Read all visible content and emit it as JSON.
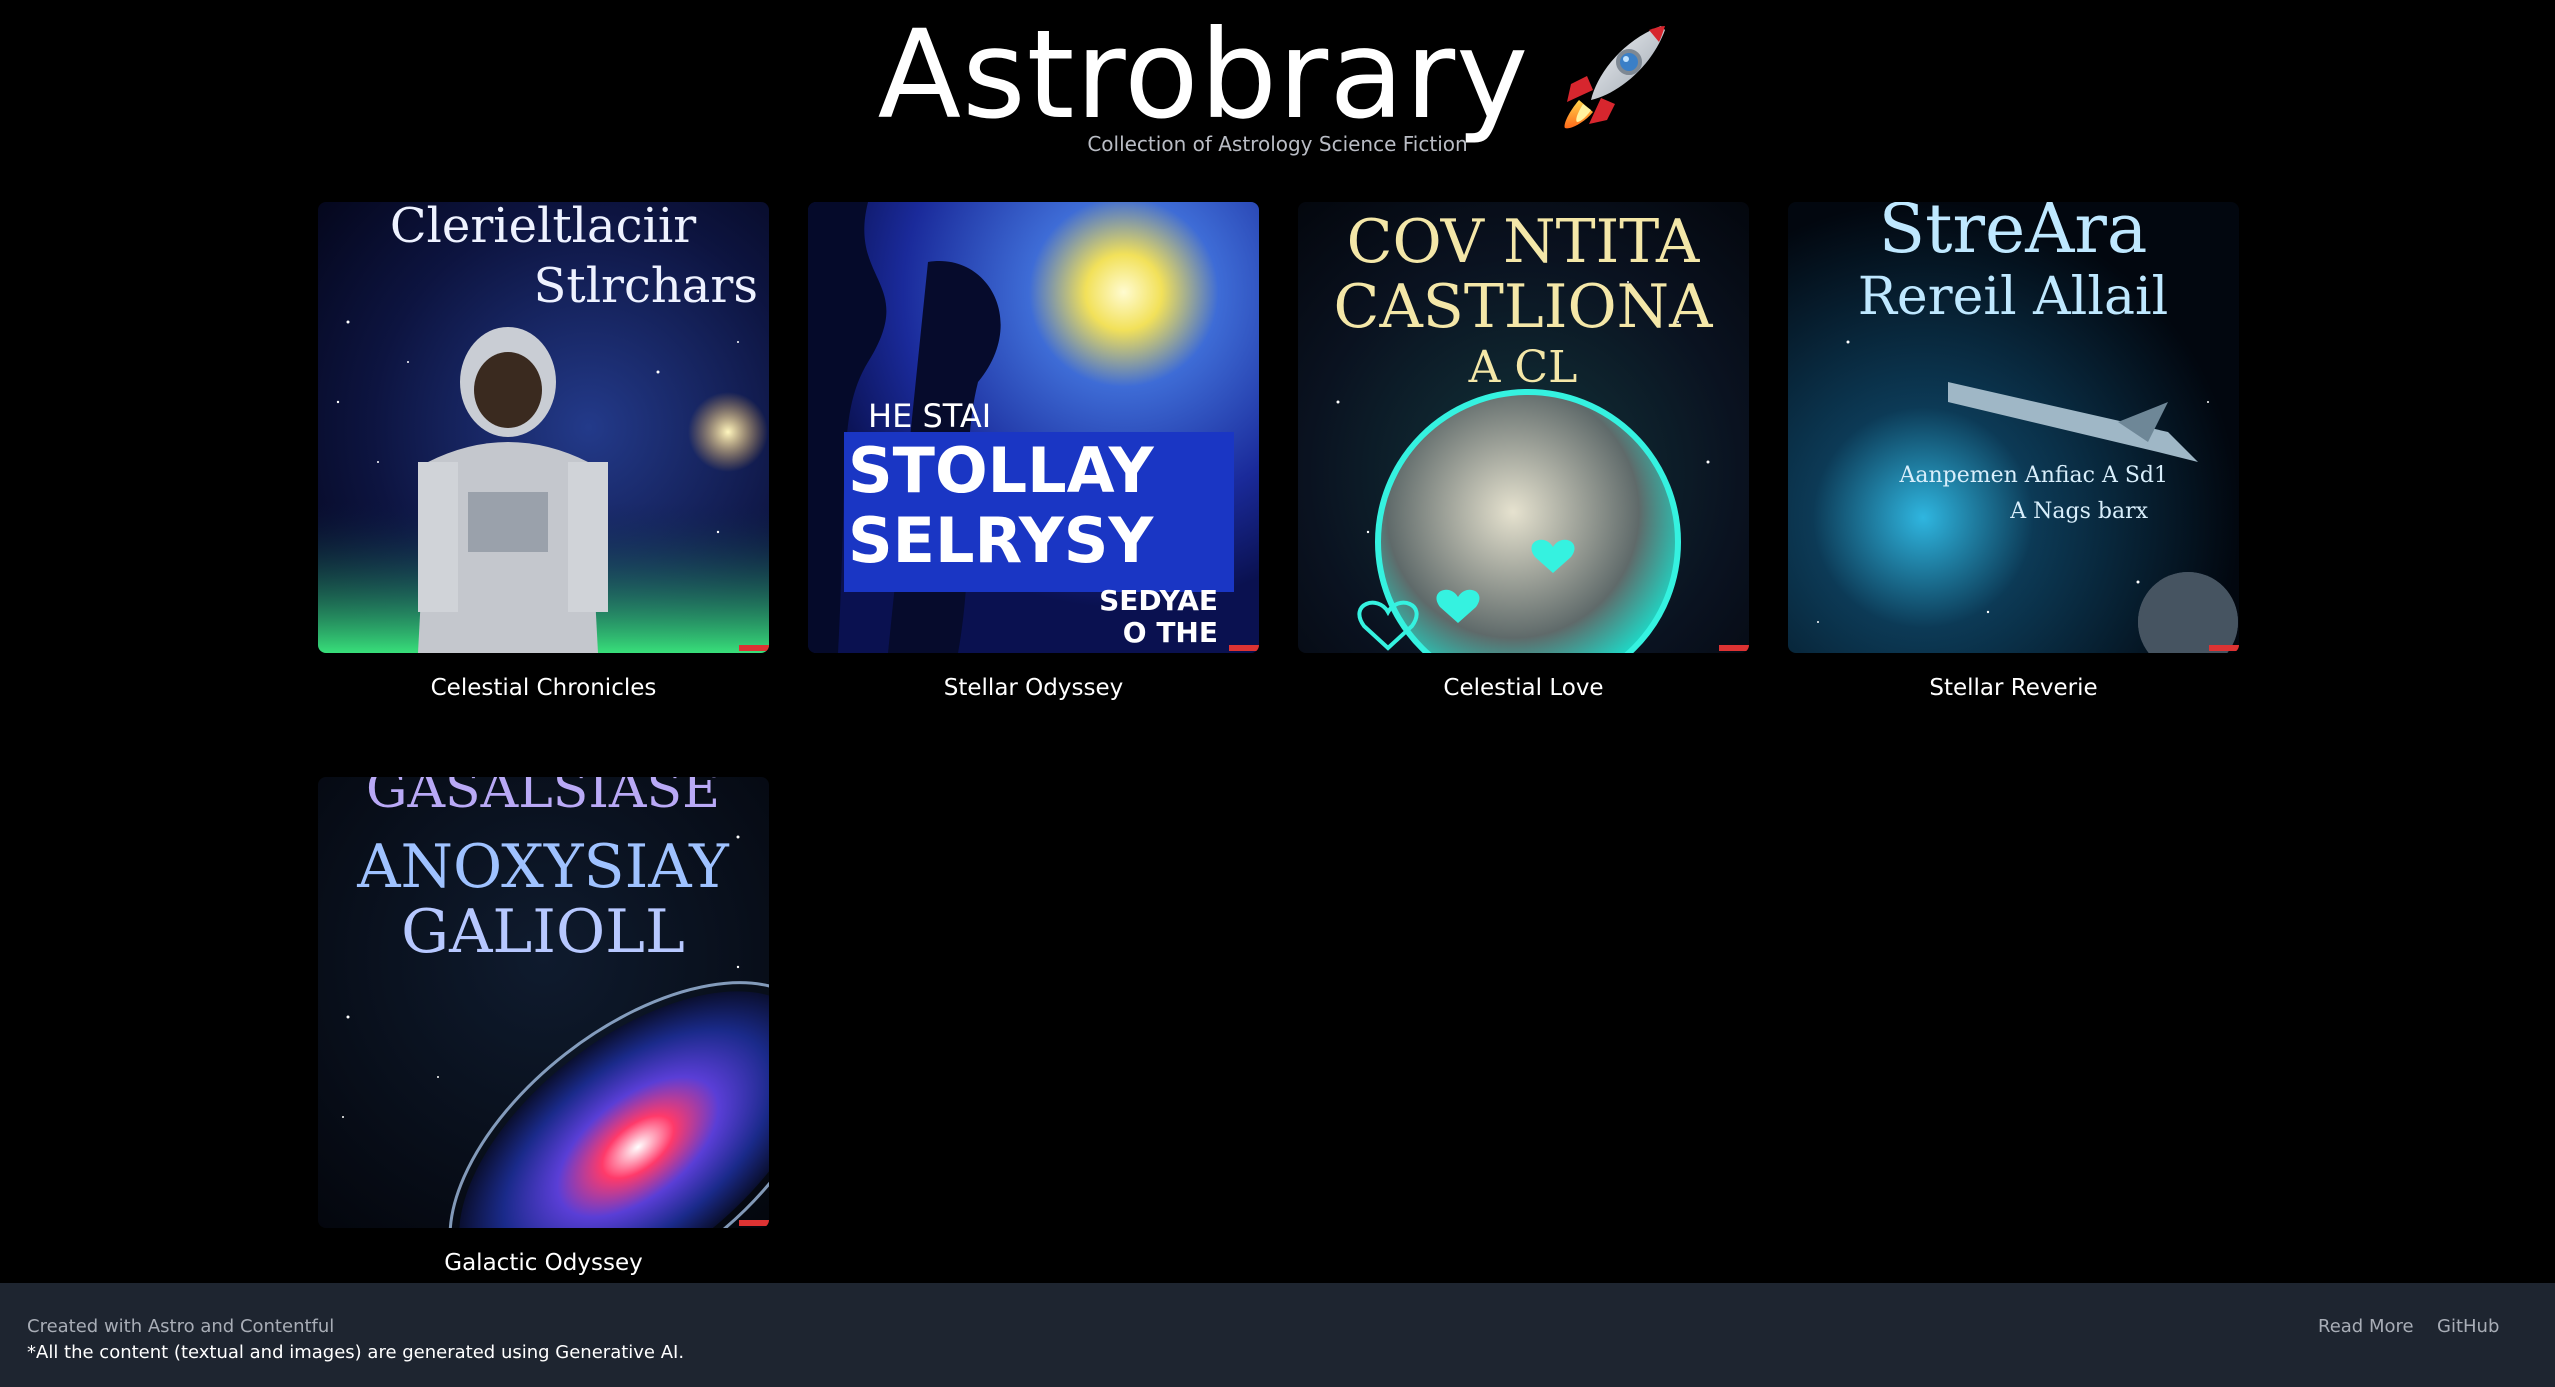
{
  "header": {
    "title": "Astrobrary",
    "title_icon": "rocket-emoji-icon",
    "subtitle": "Collection of Astrology Science Fiction"
  },
  "books": [
    {
      "title": "Celestial Chronicles",
      "cover_text": [
        "Clerieltlaciir",
        "Stlrchars"
      ],
      "accent": "#2b3f9e"
    },
    {
      "title": "Stellar Odyssey",
      "cover_text": [
        "HE STAI",
        "STOLLAY",
        "SELRYSY",
        "SEDYAE",
        "O THE"
      ],
      "accent": "#1b2d9c"
    },
    {
      "title": "Celestial Love",
      "cover_text": [
        "COV NTITA",
        "CASTLIONA",
        "A CL"
      ],
      "accent": "#1fd6c4"
    },
    {
      "title": "Stellar Reverie",
      "cover_text": [
        "StreAra",
        "Rereil Allail",
        "Aanpemen Anfiac A Sd1",
        "A Nags barx"
      ],
      "accent": "#2fb6e0"
    },
    {
      "title": "Galactic Odyssey",
      "cover_text": [
        "GASALSIASE",
        "ANOXYSIAY",
        "GALIOLL"
      ],
      "accent": "#7b4cf0"
    }
  ],
  "footer": {
    "credit": "Created with Astro and Contentful",
    "note": "*All the content (textual and images) are generated using Generative AI.",
    "links": [
      {
        "label": "Read More"
      },
      {
        "label": "GitHub"
      }
    ]
  }
}
